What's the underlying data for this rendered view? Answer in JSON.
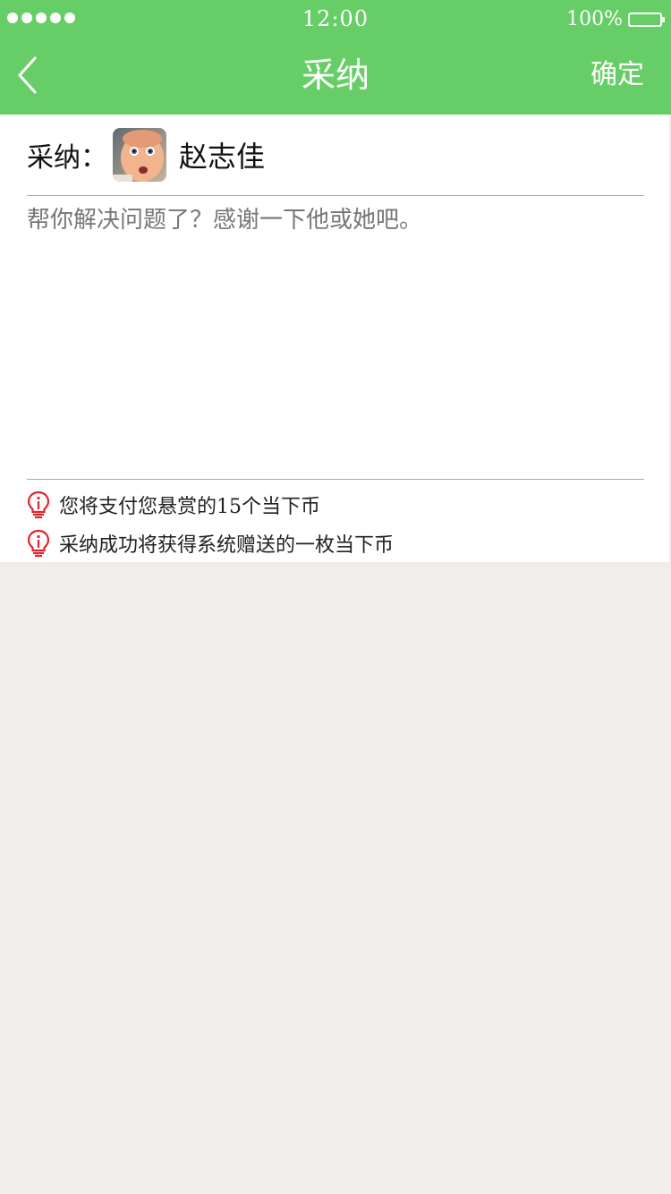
{
  "status_bar": {
    "time": "12:00",
    "battery": "100%"
  },
  "nav": {
    "title": "采纳",
    "confirm_label": "确定"
  },
  "adopt": {
    "label": "采纳：",
    "user_name": "赵志佳"
  },
  "message": {
    "placeholder": "帮你解决问题了？感谢一下他或她吧。"
  },
  "tips": [
    {
      "icon": "lightbulb-icon",
      "text": "您将支付您悬赏的15个当下币"
    },
    {
      "icon": "lightbulb-icon",
      "text": "采纳成功将获得系统赠送的一枚当下币"
    }
  ],
  "colors": {
    "nav_green": "#67ce67",
    "tip_icon_red": "#e0242b",
    "page_bg": "#efeeec"
  }
}
